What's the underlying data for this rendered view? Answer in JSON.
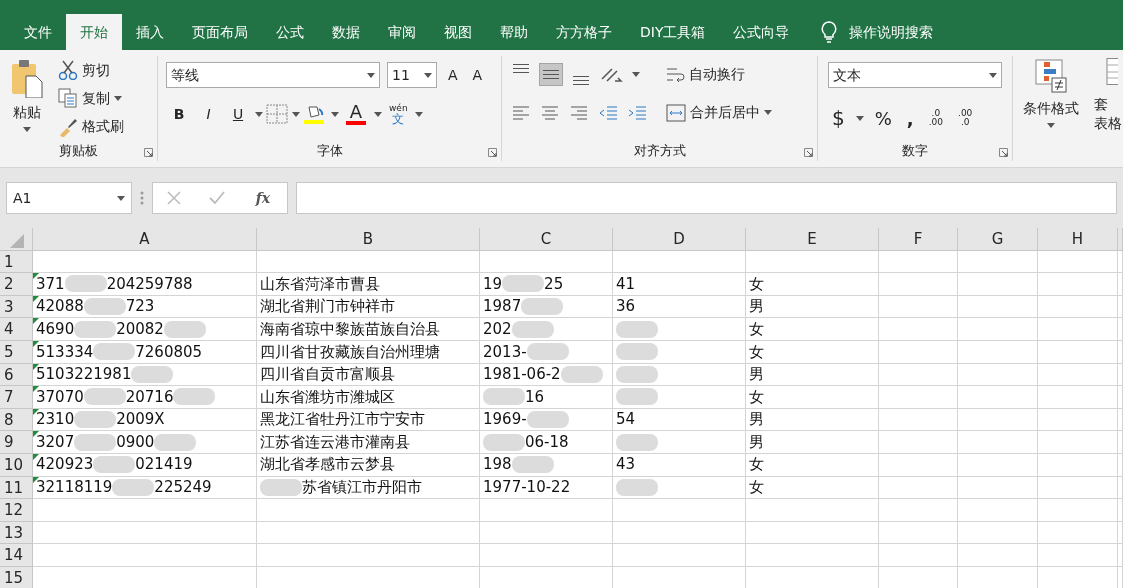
{
  "menu_tabs": [
    {
      "label": "文件",
      "selected": false
    },
    {
      "label": "开始",
      "selected": true
    },
    {
      "label": "插入",
      "selected": false
    },
    {
      "label": "页面布局",
      "selected": false
    },
    {
      "label": "公式",
      "selected": false
    },
    {
      "label": "数据",
      "selected": false
    },
    {
      "label": "审阅",
      "selected": false
    },
    {
      "label": "视图",
      "selected": false
    },
    {
      "label": "帮助",
      "selected": false
    },
    {
      "label": "方方格子",
      "selected": false
    },
    {
      "label": "DIY工具箱",
      "selected": false
    },
    {
      "label": "公式向导",
      "selected": false
    }
  ],
  "search": {
    "label": "操作说明搜索"
  },
  "clipboard": {
    "title": "剪贴板",
    "paste": "粘贴",
    "cut": "剪切",
    "copy": "复制",
    "format_painter": "格式刷"
  },
  "font": {
    "title": "字体",
    "font_name": "等线",
    "font_size": "11",
    "grow": "A",
    "shrink": "A",
    "styles": [
      "B",
      "I",
      "U"
    ],
    "font_color": "A",
    "phonetic_top": "wén",
    "phonetic_bottom": "文"
  },
  "alignment": {
    "title": "对齐方式",
    "vertical": [
      {
        "kind": "top",
        "selected": false
      },
      {
        "kind": "middle",
        "selected": true
      },
      {
        "kind": "bottom",
        "selected": false
      }
    ],
    "wrap": "自动换行",
    "merge": "合并后居中"
  },
  "number": {
    "title": "数字",
    "format": "文本",
    "currency": "$",
    "percent": "%",
    "comma": ",",
    "more_decimals": [
      ".0",
      ".00"
    ],
    "fewer_decimals": [
      ".00",
      ".0"
    ]
  },
  "styles": {
    "conditional": "条件格式",
    "table_top": "套",
    "table_bottom": "表格"
  },
  "formula_bar": {
    "name_box": "A1",
    "function_label": "fx"
  },
  "columns": [
    "A",
    "B",
    "C",
    "D",
    "E",
    "F",
    "G",
    "H"
  ],
  "rows": [
    {
      "number": "1",
      "cells": []
    },
    {
      "number": "2",
      "flag": true,
      "cells": [
        [
          {
            "kind": "text",
            "text": "371"
          },
          {
            "kind": "hidden"
          },
          {
            "kind": "text",
            "text": "204259788"
          }
        ],
        [
          {
            "kind": "text",
            "text": "山东省菏泽市曹县"
          }
        ],
        [
          {
            "kind": "text",
            "text": "19"
          },
          {
            "kind": "hidden"
          },
          {
            "kind": "text",
            "text": "25"
          }
        ],
        [
          {
            "kind": "text",
            "text": "41"
          }
        ],
        [
          {
            "kind": "text",
            "text": "女"
          }
        ]
      ]
    },
    {
      "number": "3",
      "flag": true,
      "cells": [
        [
          {
            "kind": "text",
            "text": "42088"
          },
          {
            "kind": "hidden"
          },
          {
            "kind": "text",
            "text": "723"
          }
        ],
        [
          {
            "kind": "text",
            "text": "湖北省荆门市钟祥市"
          }
        ],
        [
          {
            "kind": "text",
            "text": "1987"
          },
          {
            "kind": "hidden"
          }
        ],
        [
          {
            "kind": "text",
            "text": "36"
          }
        ],
        [
          {
            "kind": "text",
            "text": "男"
          }
        ]
      ]
    },
    {
      "number": "4",
      "flag": true,
      "cells": [
        [
          {
            "kind": "text",
            "text": "4690"
          },
          {
            "kind": "hidden"
          },
          {
            "kind": "text",
            "text": "20082"
          },
          {
            "kind": "hidden"
          }
        ],
        [
          {
            "kind": "text",
            "text": "海南省琼中黎族苗族自治县"
          }
        ],
        [
          {
            "kind": "text",
            "text": "202"
          },
          {
            "kind": "hidden"
          }
        ],
        [
          {
            "kind": "hidden"
          }
        ],
        [
          {
            "kind": "text",
            "text": "女"
          }
        ]
      ]
    },
    {
      "number": "5",
      "flag": true,
      "cells": [
        [
          {
            "kind": "text",
            "text": "513334"
          },
          {
            "kind": "hidden"
          },
          {
            "kind": "text",
            "text": "7260805"
          }
        ],
        [
          {
            "kind": "text",
            "text": "四川省甘孜藏族自治州理塘"
          }
        ],
        [
          {
            "kind": "text",
            "text": "2013-"
          },
          {
            "kind": "hidden"
          }
        ],
        [
          {
            "kind": "hidden"
          }
        ],
        [
          {
            "kind": "text",
            "text": "女"
          }
        ]
      ]
    },
    {
      "number": "6",
      "flag": true,
      "cells": [
        [
          {
            "kind": "text",
            "text": "5103221981"
          },
          {
            "kind": "hidden"
          }
        ],
        [
          {
            "kind": "text",
            "text": "四川省自贡市富顺县"
          }
        ],
        [
          {
            "kind": "text",
            "text": "1981-06-2"
          },
          {
            "kind": "hidden"
          }
        ],
        [
          {
            "kind": "hidden"
          }
        ],
        [
          {
            "kind": "text",
            "text": "男"
          }
        ]
      ]
    },
    {
      "number": "7",
      "flag": true,
      "cells": [
        [
          {
            "kind": "text",
            "text": "37070"
          },
          {
            "kind": "hidden"
          },
          {
            "kind": "text",
            "text": "20716"
          },
          {
            "kind": "hidden"
          }
        ],
        [
          {
            "kind": "text",
            "text": "山东省潍坊市潍城区"
          }
        ],
        [
          {
            "kind": "hidden"
          },
          {
            "kind": "text",
            "text": "16"
          }
        ],
        [
          {
            "kind": "hidden"
          }
        ],
        [
          {
            "kind": "text",
            "text": "女"
          }
        ]
      ]
    },
    {
      "number": "8",
      "flag": true,
      "cells": [
        [
          {
            "kind": "text",
            "text": "2310"
          },
          {
            "kind": "hidden"
          },
          {
            "kind": "text",
            "text": "2009X"
          }
        ],
        [
          {
            "kind": "text",
            "text": "黑龙江省牡丹江市宁安市"
          }
        ],
        [
          {
            "kind": "text",
            "text": "1969-"
          },
          {
            "kind": "hidden"
          }
        ],
        [
          {
            "kind": "text",
            "text": "54"
          }
        ],
        [
          {
            "kind": "text",
            "text": "男"
          }
        ]
      ]
    },
    {
      "number": "9",
      "flag": true,
      "cells": [
        [
          {
            "kind": "text",
            "text": "3207"
          },
          {
            "kind": "hidden"
          },
          {
            "kind": "text",
            "text": "0900"
          },
          {
            "kind": "hidden"
          }
        ],
        [
          {
            "kind": "text",
            "text": "江苏省连云港市灌南县"
          }
        ],
        [
          {
            "kind": "hidden"
          },
          {
            "kind": "text",
            "text": "06-18"
          }
        ],
        [
          {
            "kind": "hidden"
          }
        ],
        [
          {
            "kind": "text",
            "text": "男"
          }
        ]
      ]
    },
    {
      "number": "10",
      "flag": true,
      "cells": [
        [
          {
            "kind": "text",
            "text": "420923"
          },
          {
            "kind": "hidden"
          },
          {
            "kind": "text",
            "text": "021419"
          }
        ],
        [
          {
            "kind": "text",
            "text": "湖北省孝感市云梦县"
          }
        ],
        [
          {
            "kind": "text",
            "text": "198"
          },
          {
            "kind": "hidden"
          }
        ],
        [
          {
            "kind": "text",
            "text": "43"
          }
        ],
        [
          {
            "kind": "text",
            "text": "女"
          }
        ]
      ]
    },
    {
      "number": "11",
      "flag": true,
      "cells": [
        [
          {
            "kind": "text",
            "text": "32118119"
          },
          {
            "kind": "hidden"
          },
          {
            "kind": "text",
            "text": "225249"
          }
        ],
        [
          {
            "kind": "hidden"
          },
          {
            "kind": "text",
            "text": "苏省镇江市丹阳市"
          }
        ],
        [
          {
            "kind": "text",
            "text": "1977-10-22"
          }
        ],
        [
          {
            "kind": "hidden"
          }
        ],
        [
          {
            "kind": "text",
            "text": "女"
          }
        ]
      ]
    },
    {
      "number": "12",
      "cells": []
    },
    {
      "number": "13",
      "cells": []
    },
    {
      "number": "14",
      "cells": []
    },
    {
      "number": "15",
      "cells": []
    }
  ]
}
